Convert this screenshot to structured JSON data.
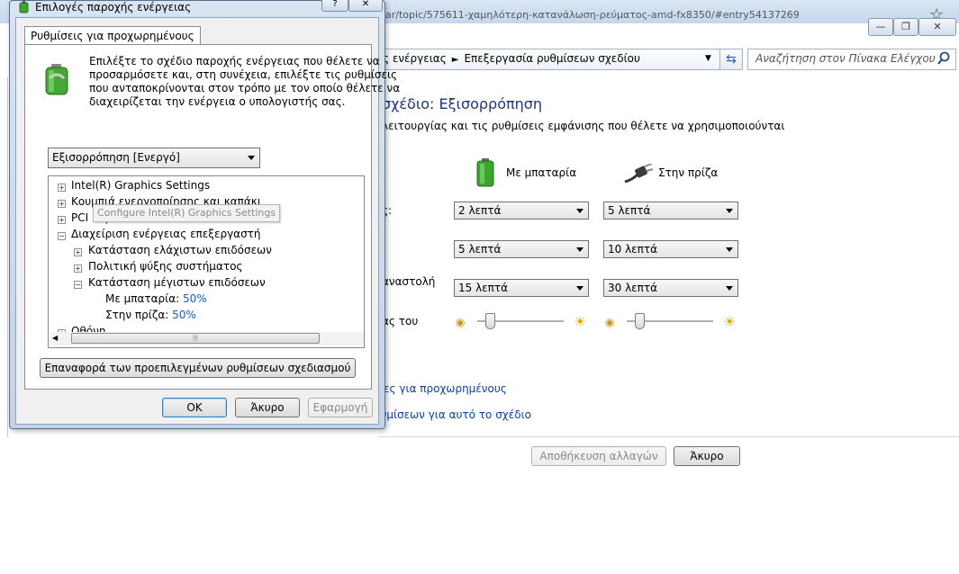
{
  "background_window": {
    "url": "ar/topic/575611-χαμηλότερη-κατανάλωση-ρεύματος-amd-fx8350/#entry54137269",
    "breadcrumb": [
      "ς ενέργειας",
      "Επεξεργασία ρυθμίσεων σχεδίου"
    ],
    "search_placeholder": "Αναζήτηση στον Πίνακα Ελέγχου",
    "plan_title": "σχέδιο: Εξισορρόπηση",
    "plan_desc": "λειτουργίας και τις ρυθμίσεις εμφάνισης που θέλετε να χρησιμοποιούνται",
    "col_battery": "Με μπαταρία",
    "col_plugged": "Στην πρίζα",
    "rows": [
      {
        "label": "ς:",
        "battery": "2 λεπτά",
        "plugged": "5 λεπτά"
      },
      {
        "label": "",
        "battery": "5 λεπτά",
        "plugged": "10 λεπτά"
      },
      {
        "label": "αναστολή",
        "battery": "15 λεπτά",
        "plugged": "30 λεπτά"
      }
    ],
    "brightness_label": "ας του",
    "brightness_battery_level": 0.15,
    "brightness_plugged_level": 0.15,
    "link_advanced": "ίες για προχωρημένους",
    "link_restore": "θμίσεων για αυτό το σχέδιο",
    "save_label": "Αποθήκευση αλλαγών",
    "cancel_label": "Άκυρο"
  },
  "dialog": {
    "title": "Επιλογές παροχής ενέργειας",
    "tab": "Ρυθμίσεις για προχωρημένους",
    "description": [
      "Επιλέξτε το σχέδιο παροχής ενέργειας που θέλετε να",
      "προσαρμόσετε και, στη συνέχεια, επιλέξτε τις ρυθμίσεις",
      "που ανταποκρίνονται στον τρόπο με τον οποίο θέλετε να",
      "διαχειρίζεται την ενέργεια ο υπολογιστής σας."
    ],
    "plan_select": "Εξισορρόπηση [Ενεργό]",
    "tree": {
      "intel": "Intel(R) Graphics Settings",
      "buttons": "Κουμπιά ενεργοποίησης και καπάκι",
      "pci": "PCI Express",
      "cpu_mgmt": "Διαχείριση ενέργειας επεξεργαστή",
      "min_state": "Κατάσταση ελάχιστων επιδόσεων",
      "cooling": "Πολιτική ψύξης συστήματος",
      "max_state": "Κατάσταση μέγιστων επιδόσεων",
      "on_battery_label": "Με μπαταρία:",
      "on_battery_value": "50%",
      "plugged_label": "Στην πρίζα:",
      "plugged_value": "50%",
      "display": "Οθόνη"
    },
    "tooltip": "Configure Intel(R) Graphics Settings",
    "restore_defaults": "Επαναφορά των προεπιλεγμένων ρυθμίσεων σχεδιασμού",
    "ok": "OK",
    "cancel": "Άκυρο",
    "apply": "Εφαρμογή"
  },
  "icons": {
    "battery": "battery-icon",
    "plug": "plug-icon",
    "sun": "brightness-icon",
    "search": "search-icon",
    "power_options": "power-options-icon"
  },
  "colors": {
    "title_blue": "#1e3287",
    "link_blue": "#0a3fb0",
    "value_blue": "#1560c8"
  }
}
